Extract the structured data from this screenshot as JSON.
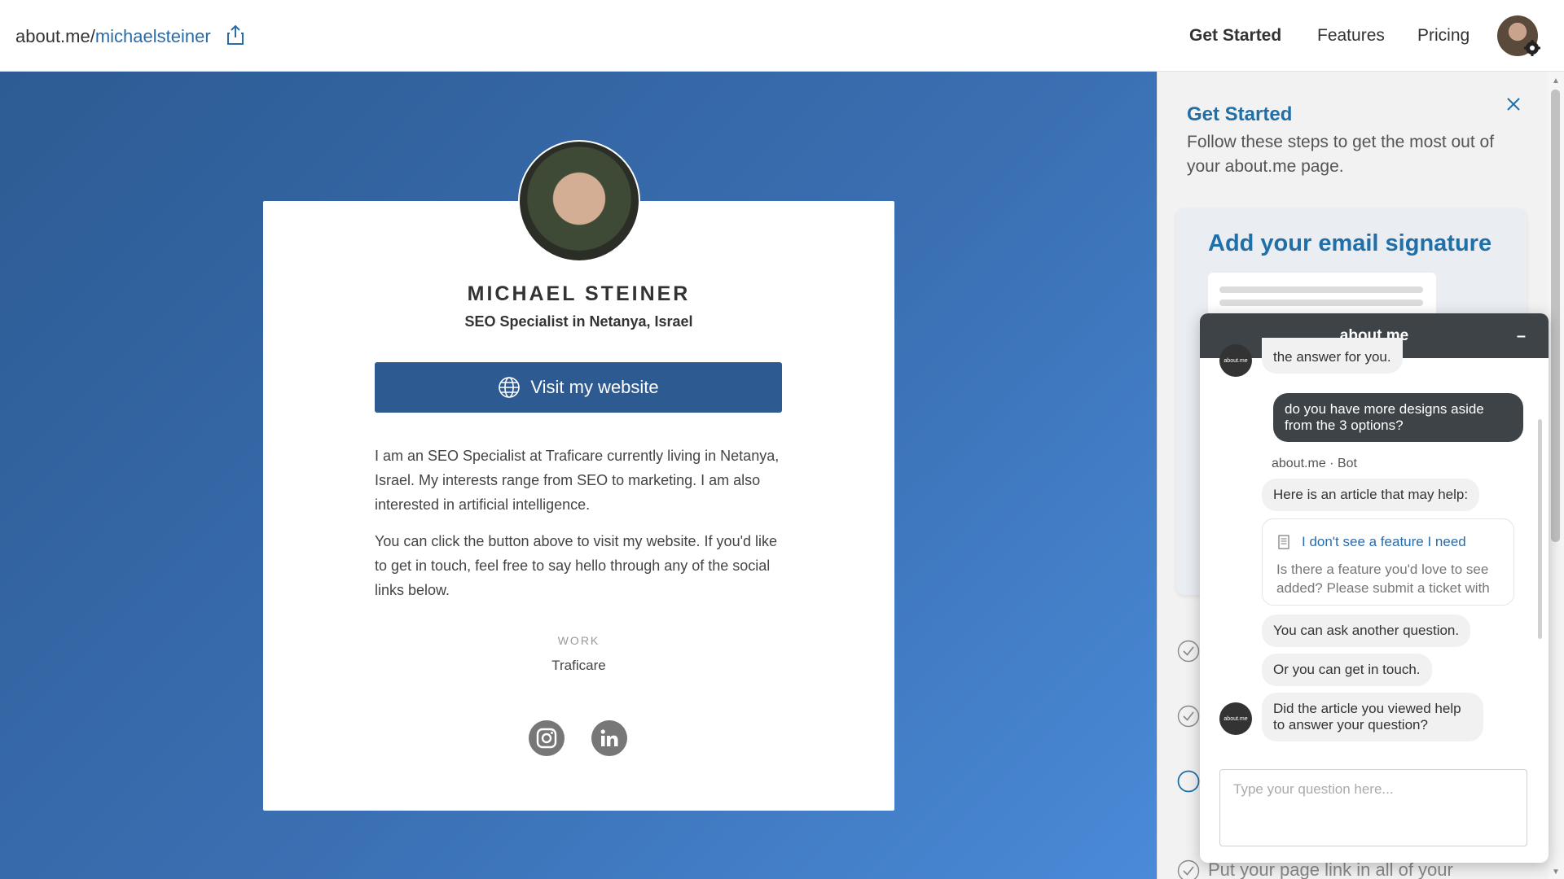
{
  "header": {
    "url_domain": "about.me/",
    "url_slug": "michaelsteiner",
    "nav": [
      "Get Started",
      "Features",
      "Pricing"
    ]
  },
  "profile": {
    "name": "MICHAEL STEINER",
    "headline": "SEO Specialist in Netanya, Israel",
    "button_label": "Visit my website",
    "bio_1": "I am an SEO Specialist at Traficare currently living in Netanya, Israel. My interests range from SEO to marketing. I am also interested in artificial intelligence.",
    "bio_2": "You can click the button above to visit my website. If you'd like to get in touch, feel free to say hello through any of the social links below.",
    "work_label": "WORK",
    "work_value": "Traficare",
    "social": [
      "instagram",
      "linkedin"
    ]
  },
  "panel": {
    "title": "Get Started",
    "subtitle": "Follow these steps to get the most out of your about.me page.",
    "card_title": "Add your email signature",
    "next_step": "Put your page link in all of your"
  },
  "chat": {
    "title": "about.me",
    "minimize": "–",
    "msg_partial": "the answer for you.",
    "user_msg": "do you have more designs aside from the 3 options?",
    "bot_name": "about.me",
    "bot_role": "Bot",
    "bot_msg_1": "Here is an article that may help:",
    "article_title": "I don't see a feature I need",
    "article_desc": "Is there a feature you'd love to see added? Please submit a ticket with",
    "bot_msg_2": "You can ask another question.",
    "bot_msg_3": "Or you can get in touch.",
    "bot_msg_4": "Did the article you viewed help to answer your question?",
    "avatar_text": "about.me",
    "input_placeholder": "Type your question here..."
  },
  "colors": {
    "accent": "#1f6fa8",
    "button": "#2e5a92",
    "chat_header": "#3d4347"
  }
}
